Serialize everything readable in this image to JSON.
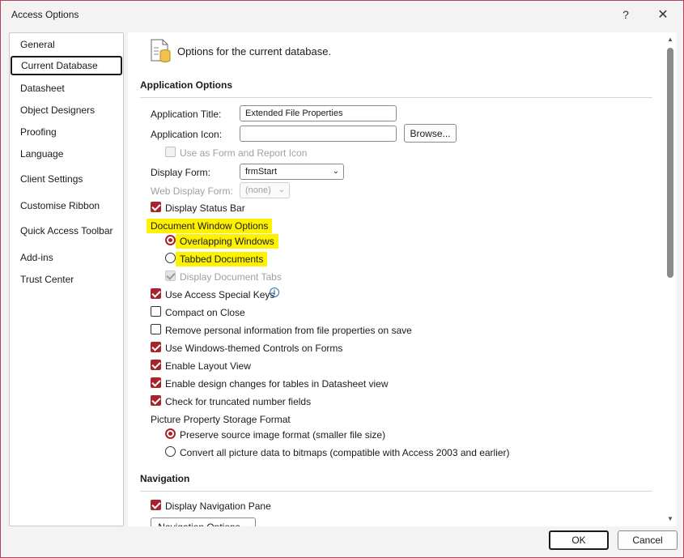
{
  "window": {
    "title": "Access Options",
    "help_glyph": "?",
    "close_glyph": "✕"
  },
  "sidebar": {
    "items": [
      {
        "label": "General"
      },
      {
        "label": "Current Database",
        "selected": true
      },
      {
        "label": "Datasheet"
      },
      {
        "label": "Object Designers"
      },
      {
        "label": "Proofing"
      },
      {
        "label": "Language"
      },
      {
        "label": "Client Settings"
      },
      {
        "label": "Customise Ribbon"
      },
      {
        "label": "Quick Access Toolbar"
      },
      {
        "label": "Add-ins"
      },
      {
        "label": "Trust Center"
      }
    ]
  },
  "header": {
    "text": "Options for the current database.",
    "icon": "database-options-icon"
  },
  "application_options": {
    "title": "Application Options",
    "app_title_label": "Application Title:",
    "app_title_value": "Extended File Properties",
    "app_icon_label": "Application Icon:",
    "app_icon_value": "",
    "browse_label": "Browse...",
    "use_as_form_icon_label": "Use as Form and Report Icon",
    "display_form_label": "Display Form:",
    "display_form_value": "frmStart",
    "web_display_form_label": "Web Display Form:",
    "web_display_form_value": "(none)",
    "display_status_bar_label": "Display Status Bar",
    "doc_window_options_label": "Document Window Options",
    "overlapping_windows_label": "Overlapping Windows",
    "tabbed_documents_label": "Tabbed Documents",
    "display_document_tabs_label": "Display Document Tabs",
    "use_special_keys_label": "Use Access Special Keys",
    "info_glyph": "i",
    "compact_on_close_label": "Compact on Close",
    "remove_personal_info_label": "Remove personal information from file properties on save",
    "windows_themed_controls_label": "Use Windows-themed Controls on Forms",
    "enable_layout_view_label": "Enable Layout View",
    "enable_design_changes_label": "Enable design changes for tables in Datasheet view",
    "check_truncated_label": "Check for truncated number fields",
    "picture_storage_label": "Picture Property Storage Format",
    "preserve_source_label": "Preserve source image format (smaller file size)",
    "convert_bitmaps_label": "Convert all picture data to bitmaps (compatible with Access 2003 and earlier)"
  },
  "navigation": {
    "title": "Navigation",
    "display_nav_pane_label": "Display Navigation Pane",
    "nav_options_label": "Navigation Options..."
  },
  "scrollbar": {
    "up_glyph": "▲",
    "down_glyph": "▼"
  },
  "footer": {
    "ok_label": "OK",
    "cancel_label": "Cancel"
  },
  "colors": {
    "accent": "#a4262c",
    "highlight": "#fff200",
    "border": "#b8435a"
  }
}
